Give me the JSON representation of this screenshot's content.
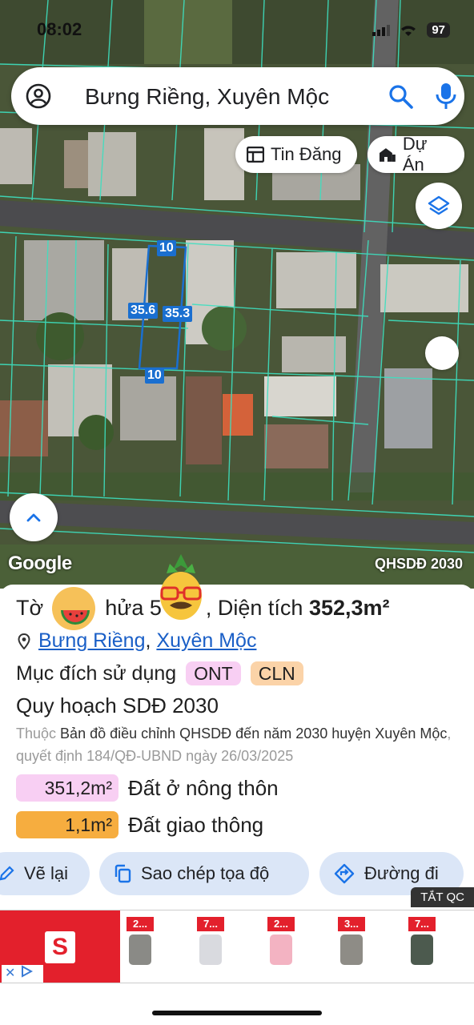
{
  "status": {
    "time": "08:02",
    "battery": "97"
  },
  "search": {
    "text": "Bưng Riềng, Xuyên Mộc"
  },
  "chips": {
    "tin_dang": "Tin Đăng",
    "du_an": "Dự Án"
  },
  "map": {
    "dimensions": {
      "top": "10",
      "left": "35.6",
      "right": "35.3",
      "bottom": "10"
    },
    "google": "Google",
    "layer_label": "QHSDĐ 2030"
  },
  "parcel": {
    "title_prefix": "Tờ",
    "title_middle": "hửa 5",
    "title_suffix": ", Diện tích",
    "area": "352,3m²",
    "location_commune": "Bưng Riềng",
    "location_sep": ",",
    "location_district": "Xuyên Mộc",
    "purpose_label": "Mục đích sử dụng",
    "purpose_tags": [
      "ONT",
      "CLN"
    ],
    "plan_title": "Quy hoạch SDĐ 2030",
    "source_prefix": "Thuộc",
    "source_name": "Bản đồ điều chỉnh QHSDĐ đến năm 2030 huyện Xuyên Mộc",
    "source_suffix": ", quyết định 184/QĐ-UBND ngày 26/03/2025",
    "land_uses": [
      {
        "area": "351,2m²",
        "name": "Đất ở nông thôn",
        "color": "#f8cff3"
      },
      {
        "area": "1,1m²",
        "name": "Đất giao thông",
        "color": "#f6ad3f"
      }
    ]
  },
  "actions": {
    "redraw": "Vẽ lại",
    "copy_coords": "Sao chép tọa độ",
    "directions": "Đường đi"
  },
  "ad": {
    "close_label": "TẮT QC",
    "logo_letter": "S",
    "prices": [
      "2...",
      "7...",
      "2...",
      "3...",
      "7..."
    ]
  }
}
